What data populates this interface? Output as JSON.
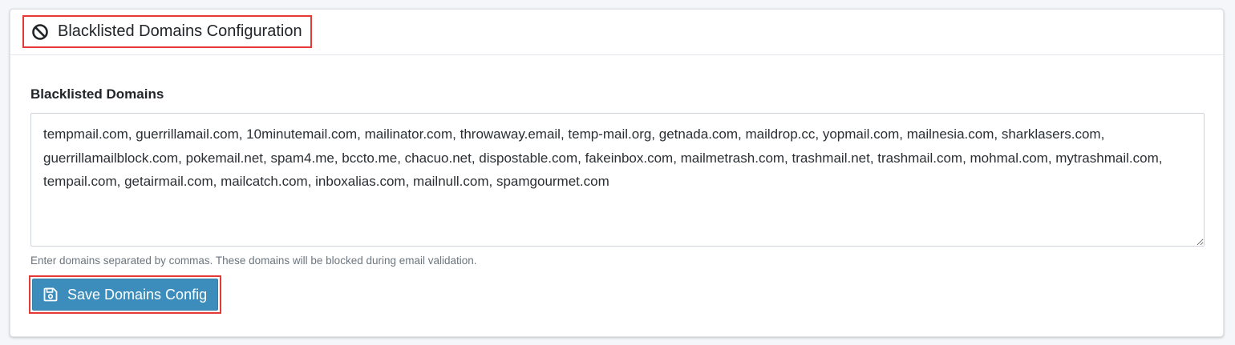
{
  "card": {
    "title": "Blacklisted Domains Configuration",
    "title_icon": "ban-icon"
  },
  "form": {
    "label": "Blacklisted Domains",
    "value": "tempmail.com, guerrillamail.com, 10minutemail.com, mailinator.com, throwaway.email, temp-mail.org, getnada.com, maildrop.cc, yopmail.com, mailnesia.com, sharklasers.com, guerrillamailblock.com, pokemail.net, spam4.me, bccto.me, chacuo.net, dispostable.com, fakeinbox.com, mailmetrash.com, trashmail.net, trashmail.com, mohmal.com, mytrashmail.com, tempail.com, getairmail.com, mailcatch.com, inboxalias.com, mailnull.com, spamgourmet.com",
    "help": "Enter domains separated by commas. These domains will be blocked during email validation."
  },
  "actions": {
    "save_label": "Save Domains Config",
    "save_icon": "save-icon"
  },
  "colors": {
    "primary": "#3c8dbc",
    "highlight": "#e53935"
  }
}
